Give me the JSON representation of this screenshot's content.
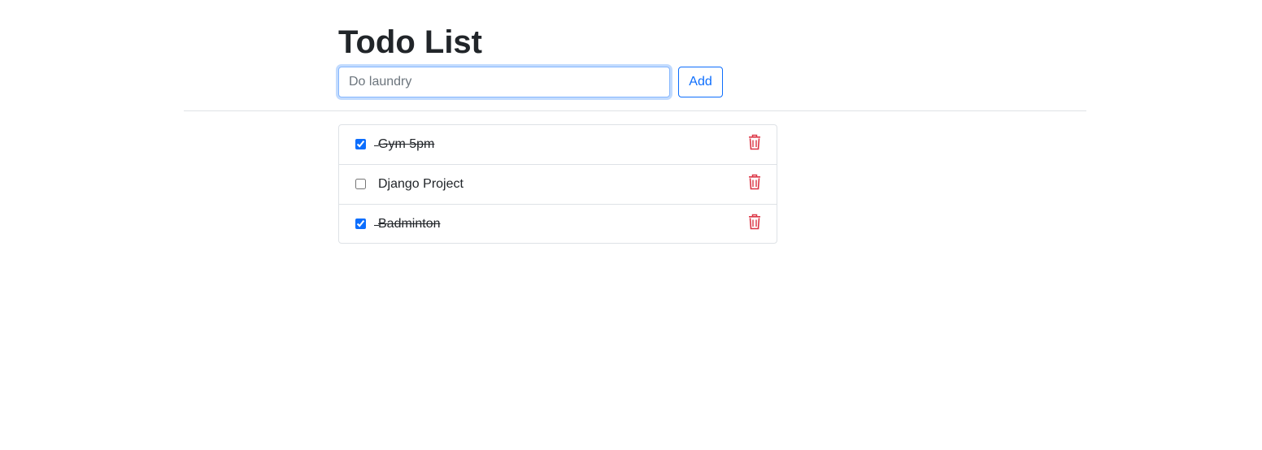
{
  "header": {
    "title": "Todo List"
  },
  "form": {
    "input_value": "",
    "input_placeholder": "Do laundry",
    "add_label": "Add"
  },
  "todos": [
    {
      "text": "Gym 5pm",
      "done": true
    },
    {
      "text": "Django Project",
      "done": false
    },
    {
      "text": "Badminton",
      "done": true
    }
  ],
  "colors": {
    "accent": "#0d6efd",
    "delete": "#dc3545",
    "text": "#212529",
    "border": "#dee2e6"
  },
  "icons": {
    "delete": "trash-icon"
  }
}
